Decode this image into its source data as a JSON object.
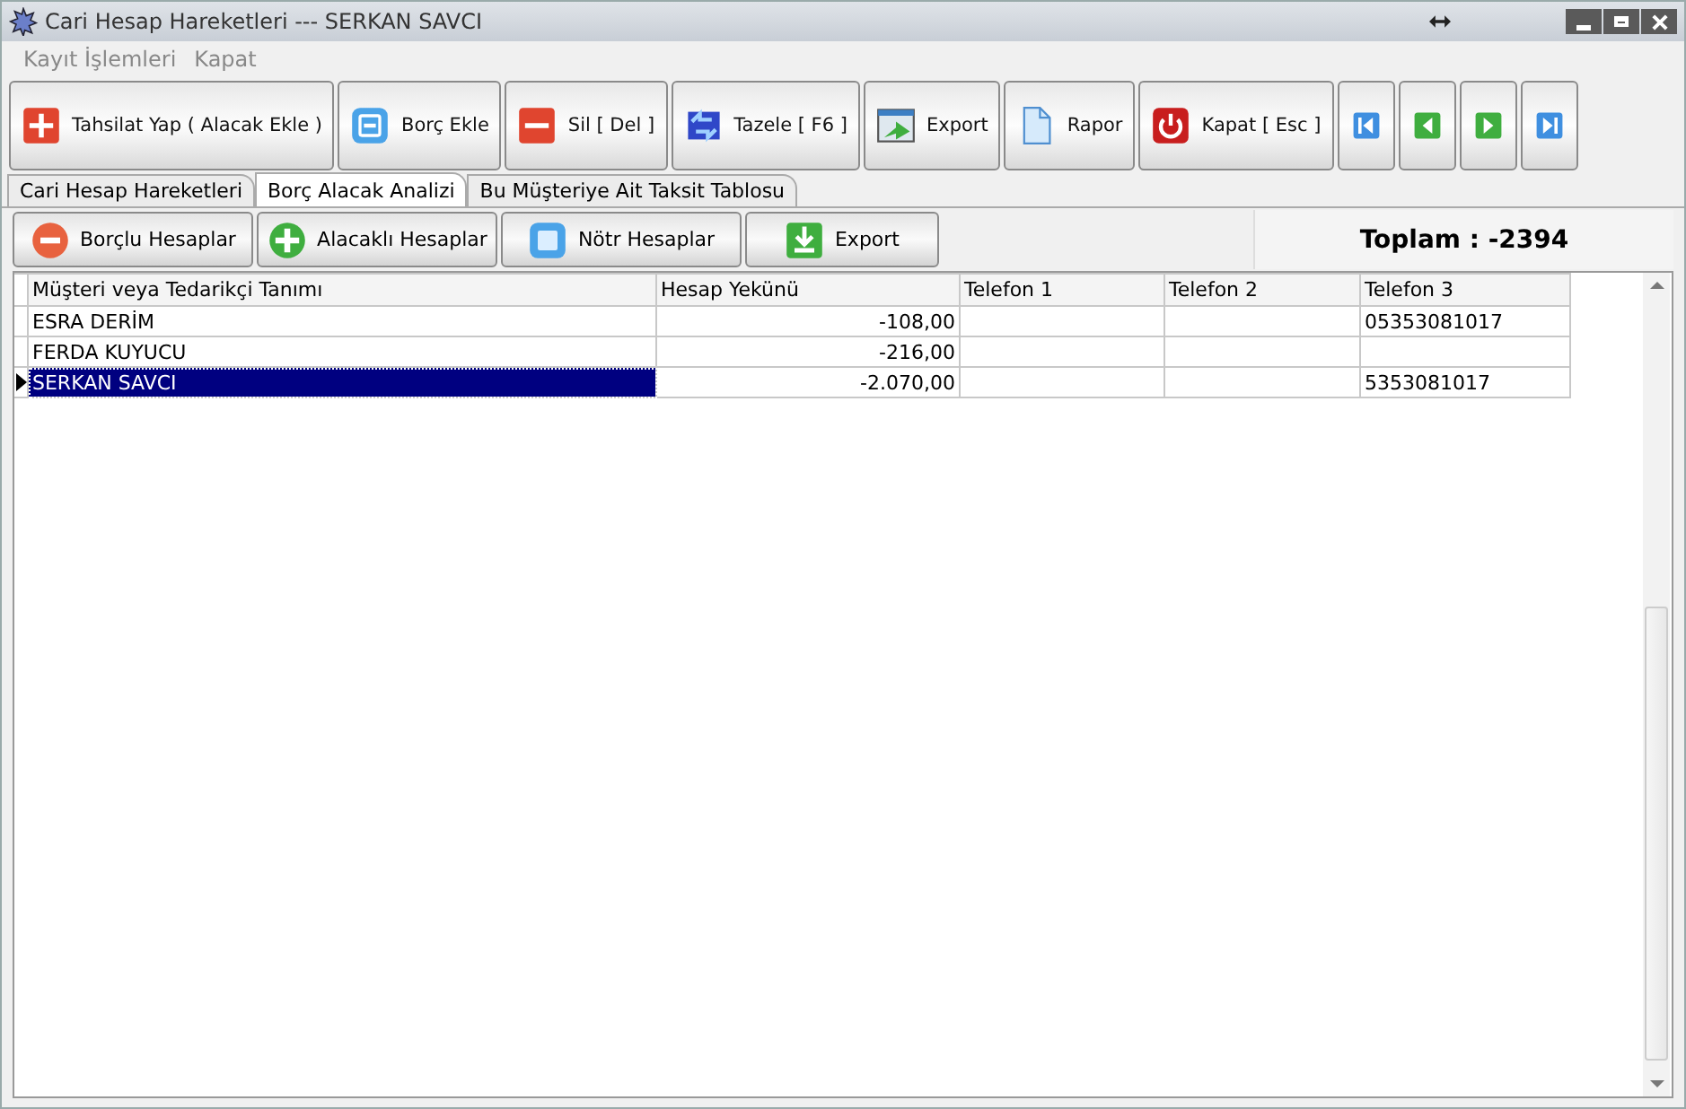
{
  "window": {
    "title": "Cari Hesap Hareketleri  ---  SERKAN SAVCI"
  },
  "menu": [
    "Kayıt İşlemleri",
    "Kapat"
  ],
  "toolbar": [
    {
      "label": "Tahsilat Yap ( Alacak Ekle )",
      "kind": "plus"
    },
    {
      "label": "Borç Ekle",
      "kind": "minusblue"
    },
    {
      "label": "Sil [ Del ]",
      "kind": "minusred"
    },
    {
      "label": "Tazele [ F6 ]",
      "kind": "refresh"
    },
    {
      "label": "Export",
      "kind": "export"
    },
    {
      "label": "Rapor",
      "kind": "document"
    },
    {
      "label": "Kapat  [ Esc ]",
      "kind": "power"
    },
    {
      "kind": "first"
    },
    {
      "kind": "prev"
    },
    {
      "kind": "next"
    },
    {
      "kind": "last"
    }
  ],
  "tabs": [
    {
      "label": "Cari Hesap Hareketleri",
      "selected": false
    },
    {
      "label": "Borç Alacak Analizi",
      "selected": true
    },
    {
      "label": "Bu Müşteriye Ait Taksit Tablosu",
      "selected": false
    }
  ],
  "filters": [
    {
      "label": "Borçlu Hesaplar",
      "kind": "minus"
    },
    {
      "label": "Alacaklı Hesaplar",
      "kind": "plus"
    },
    {
      "label": "Nötr Hesaplar",
      "kind": "square"
    },
    {
      "label": "Export",
      "kind": "download"
    }
  ],
  "total": "Toplam : -2394",
  "table": {
    "columns": [
      "Müşteri veya Tedarikçi Tanımı",
      "Hesap Yekünü",
      "Telefon 1",
      "Telefon 2",
      "Telefon 3"
    ],
    "rows": [
      {
        "cells": [
          "ESRA DERİM",
          "-108,00",
          "",
          "",
          "05353081017"
        ],
        "selected": false
      },
      {
        "cells": [
          "FERDA KUYUCU",
          "-216,00",
          "",
          "",
          ""
        ],
        "selected": false
      },
      {
        "cells": [
          "SERKAN SAVCI",
          "-2.070,00",
          "",
          "",
          "5353081017"
        ],
        "selected": true
      }
    ]
  }
}
